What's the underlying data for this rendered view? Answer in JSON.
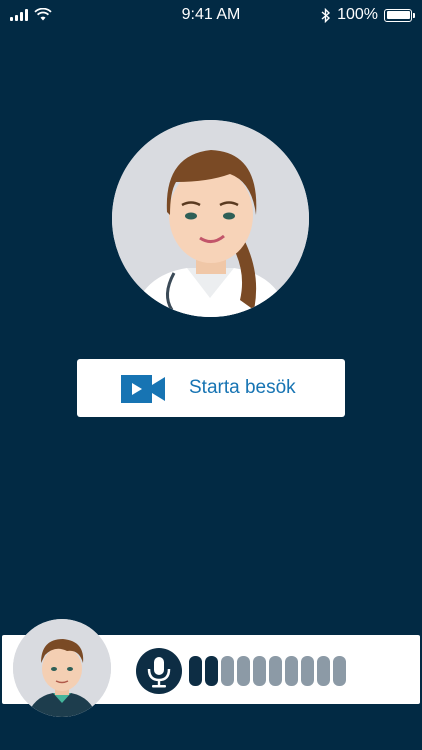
{
  "status_bar": {
    "time": "9:41 AM",
    "battery_text": "100%",
    "signal_icon": "cellular-signal-icon",
    "wifi_icon": "wifi-icon",
    "bluetooth_icon": "bluetooth-icon",
    "battery_icon": "battery-icon"
  },
  "doctor": {
    "avatar_icon": "doctor-avatar"
  },
  "start_visit": {
    "label": "Starta besök",
    "icon": "video-camera-icon",
    "color": "#1774b3"
  },
  "call_bar": {
    "user_avatar_icon": "patient-avatar",
    "mic_icon": "microphone-icon",
    "mic_level": {
      "active": 2,
      "total": 10
    }
  },
  "colors": {
    "background": "#022a44",
    "accent": "#1774b3",
    "dark": "#0d2d44",
    "inactive": "#8c9aa6"
  }
}
